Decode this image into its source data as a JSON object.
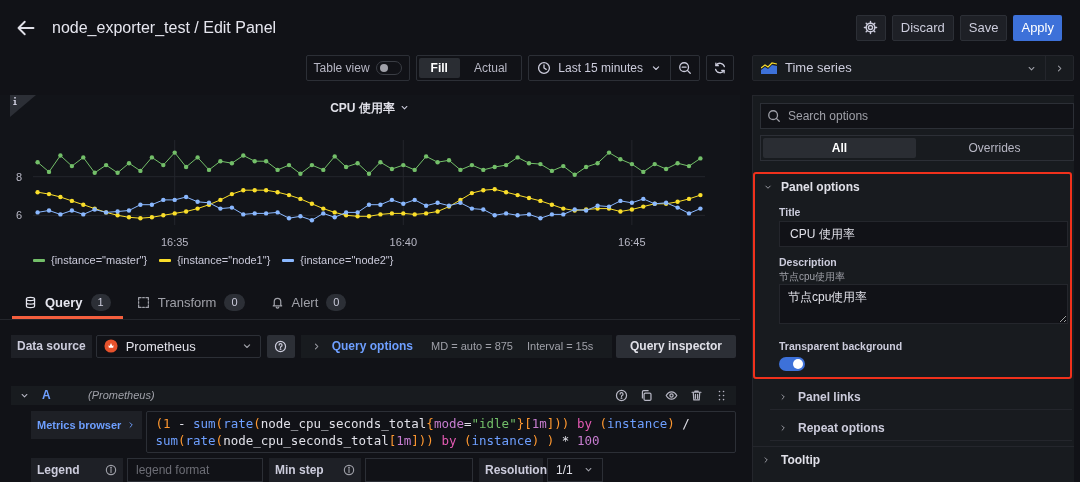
{
  "header": {
    "title": "node_exporter_test / Edit Panel",
    "buttons": [
      {
        "label": "Discard",
        "kind": "secondary"
      },
      {
        "label": "Save",
        "kind": "secondary"
      },
      {
        "label": "Apply",
        "kind": "primary"
      }
    ]
  },
  "toolbar": {
    "table_view": {
      "label": "Table view",
      "on": false
    },
    "size_modes": [
      {
        "label": "Fill",
        "selected": true
      },
      {
        "label": "Actual",
        "selected": false
      }
    ],
    "time_range": "Last 15 minutes"
  },
  "panel": {
    "title": "CPU 使用率",
    "chart_data": {
      "type": "line",
      "categories": [
        null,
        null,
        null,
        null,
        null,
        null,
        null,
        null,
        null,
        null,
        null,
        null,
        "16:35",
        null,
        null,
        null,
        null,
        null,
        null,
        null,
        null,
        null,
        null,
        null,
        null,
        null,
        null,
        null,
        null,
        null,
        null,
        null,
        "16:40",
        null,
        null,
        null,
        null,
        null,
        null,
        null,
        null,
        null,
        null,
        null,
        null,
        null,
        null,
        null,
        null,
        null,
        null,
        null,
        "16:45",
        null,
        null,
        null,
        null,
        null,
        null
      ],
      "series": [
        {
          "name": "{instance=\"master\"}",
          "color": "#73bf69",
          "values": [
            8.75,
            8.25,
            9.1,
            8.55,
            9.0,
            8.2,
            8.6,
            8.2,
            8.7,
            8.3,
            9.0,
            8.6,
            9.25,
            8.5,
            9.0,
            8.35,
            8.8,
            8.7,
            9.1,
            8.8,
            8.8,
            8.35,
            8.6,
            8.15,
            8.6,
            8.35,
            9.05,
            8.5,
            8.7,
            8.15,
            8.75,
            8.4,
            8.6,
            8.35,
            9.05,
            8.75,
            8.85,
            8.35,
            8.6,
            8.35,
            8.5,
            8.6,
            9.0,
            8.7,
            8.65,
            8.3,
            8.55,
            8.1,
            8.5,
            8.7,
            9.25,
            8.9,
            8.65,
            8.25,
            8.65,
            8.4,
            8.7,
            8.55,
            8.95
          ]
        },
        {
          "name": "{instance=\"node1\"}",
          "color": "#fade2a",
          "values": [
            7.2,
            7.1,
            6.95,
            6.75,
            6.55,
            6.35,
            6.15,
            6.0,
            5.9,
            5.85,
            5.9,
            6.0,
            6.1,
            6.2,
            6.35,
            6.55,
            6.8,
            7.1,
            7.3,
            7.3,
            7.3,
            7.2,
            7.05,
            6.85,
            6.6,
            6.35,
            6.15,
            6.0,
            5.95,
            5.95,
            6.05,
            6.1,
            6.1,
            6.05,
            6.1,
            6.2,
            6.45,
            6.8,
            7.15,
            7.3,
            7.35,
            7.2,
            7.05,
            6.9,
            6.75,
            6.55,
            6.35,
            6.25,
            6.3,
            6.35,
            6.35,
            6.2,
            6.3,
            6.45,
            6.6,
            6.6,
            6.7,
            6.85,
            7.05
          ]
        },
        {
          "name": "{instance=\"node2\"}",
          "color": "#8ab8ff",
          "values": [
            6.15,
            6.25,
            6.05,
            6.25,
            6.05,
            6.3,
            6.15,
            6.2,
            6.25,
            6.55,
            6.55,
            6.8,
            6.8,
            6.95,
            6.7,
            6.65,
            6.35,
            6.4,
            6.05,
            6.1,
            6.1,
            6.15,
            5.85,
            5.95,
            5.75,
            6.1,
            5.9,
            6.15,
            6.15,
            6.55,
            6.55,
            6.8,
            6.6,
            6.8,
            6.5,
            6.65,
            6.5,
            6.65,
            6.35,
            6.3,
            6.0,
            6.1,
            6.0,
            6.05,
            5.85,
            6.05,
            6.05,
            6.3,
            6.25,
            6.5,
            6.45,
            6.75,
            6.65,
            6.85,
            6.6,
            6.65,
            6.4,
            6.1,
            6.35
          ]
        }
      ],
      "ylim": [
        5.5,
        9.9
      ],
      "grid": true,
      "yticks": [
        6,
        8
      ]
    }
  },
  "query_tabs": [
    {
      "label": "Query",
      "count": "1",
      "selected": true
    },
    {
      "label": "Transform",
      "count": "0",
      "selected": false
    },
    {
      "label": "Alert",
      "count": "0",
      "selected": false
    }
  ],
  "data_source": {
    "label": "Data source",
    "value": "Prometheus"
  },
  "query_options": {
    "label": "Query options",
    "md": "MD = auto = 875",
    "interval": "Interval = 15s"
  },
  "query_inspector": "Query inspector",
  "query": {
    "ref": "A",
    "source": "(Prometheus)",
    "expanded": true,
    "metrics_browser": "Metrics browser",
    "lines": [
      [
        {
          "text": "(1",
          "kind": "paren"
        },
        {
          "text": " - ",
          "kind": "plain"
        },
        {
          "text": "sum",
          "kind": "func"
        },
        {
          "text": "(",
          "kind": "paren"
        },
        {
          "text": "rate",
          "kind": "func"
        },
        {
          "text": "(",
          "kind": "paren"
        },
        {
          "text": "node_cpu_seconds_total",
          "kind": "plain"
        },
        {
          "text": "{",
          "kind": "paren"
        },
        {
          "text": "mode",
          "kind": "label"
        },
        {
          "text": "=",
          "kind": "plain"
        },
        {
          "text": "\"idle\"",
          "kind": "string"
        },
        {
          "text": "}[",
          "kind": "paren"
        },
        {
          "text": "1m",
          "kind": "number"
        },
        {
          "text": "]))",
          "kind": "paren"
        },
        {
          "text": " by ",
          "kind": "keyword"
        },
        {
          "text": "(",
          "kind": "paren"
        },
        {
          "text": "instance",
          "kind": "func"
        },
        {
          "text": ")",
          "kind": "paren"
        },
        {
          "text": " /",
          "kind": "plain"
        }
      ],
      [
        {
          "text": "sum",
          "kind": "func"
        },
        {
          "text": "(",
          "kind": "paren"
        },
        {
          "text": "rate",
          "kind": "func"
        },
        {
          "text": "(",
          "kind": "paren"
        },
        {
          "text": "node_cpu_seconds_total",
          "kind": "plain"
        },
        {
          "text": "[",
          "kind": "paren"
        },
        {
          "text": "1m",
          "kind": "number"
        },
        {
          "text": "]))",
          "kind": "paren"
        },
        {
          "text": " by ",
          "kind": "keyword"
        },
        {
          "text": "(",
          "kind": "paren"
        },
        {
          "text": "instance",
          "kind": "func"
        },
        {
          "text": ") )",
          "kind": "paren"
        },
        {
          "text": " * ",
          "kind": "plain"
        },
        {
          "text": "100",
          "kind": "number"
        }
      ]
    ],
    "fields": [
      {
        "kind": "text",
        "label": "Legend",
        "placeholder": "legend format"
      },
      {
        "kind": "text",
        "label": "Min step"
      },
      {
        "kind": "select",
        "label": "Resolution",
        "value": "1/1"
      }
    ]
  },
  "options_pane": {
    "visualization": "Time series",
    "search_placeholder": "Search options",
    "tabs": [
      {
        "label": "All",
        "selected": true
      },
      {
        "label": "Overrides",
        "selected": false
      }
    ],
    "panel_options": {
      "title": "Panel options",
      "expanded": true,
      "highlighted": true,
      "fields": [
        {
          "kind": "input",
          "label": "Title",
          "value": "CPU 使用率"
        },
        {
          "kind": "textarea",
          "label": "Description",
          "description": "节点cpu使用率",
          "value": "节点cpu使用率"
        },
        {
          "kind": "switch",
          "label": "Transparent background",
          "on": true
        }
      ],
      "subsections": [
        {
          "title": "Panel links",
          "expanded": false
        },
        {
          "title": "Repeat options",
          "expanded": false
        }
      ]
    },
    "sections": [
      {
        "title": "Tooltip",
        "expanded": false
      }
    ]
  }
}
